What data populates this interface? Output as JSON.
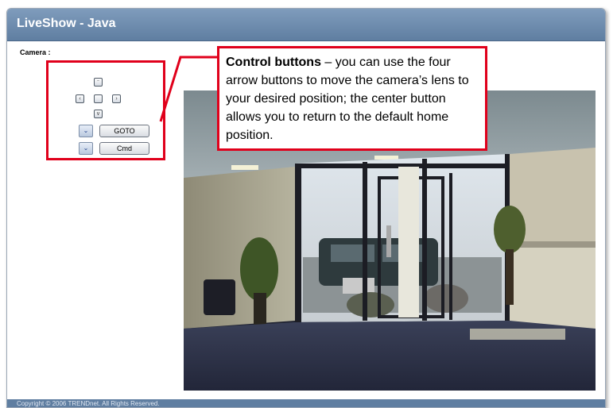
{
  "window": {
    "title": "LiveShow - Java"
  },
  "camera": {
    "label": "Camera :"
  },
  "controls": {
    "up_icon": "arrow-up-icon",
    "left_icon": "arrow-left-icon",
    "home_icon": "home-center-icon",
    "right_icon": "arrow-right-icon",
    "down_icon": "arrow-down-icon",
    "goto_label": "GOTO",
    "cmd_label": "Cmd"
  },
  "callout": {
    "heading": "Control buttons",
    "body": " – you can use the four arrow buttons to move the camera’s lens to your desired position; the center button allows you to return to the default home position."
  },
  "footer": {
    "copyright": "Copyright © 2006 TRENDnet. All Rights Reserved."
  },
  "colors": {
    "title_bar": "#6b89ab",
    "annotation": "#e0001b"
  }
}
